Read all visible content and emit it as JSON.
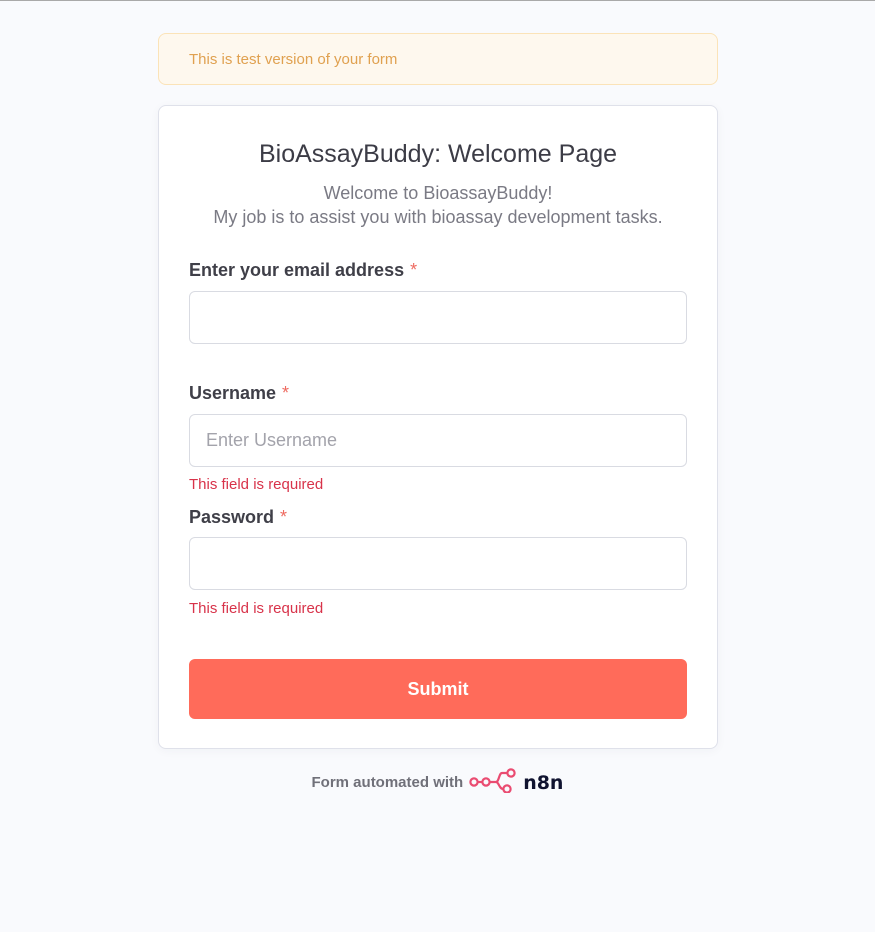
{
  "banner": {
    "text": "This is test version of your form"
  },
  "form": {
    "title": "BioAssayBuddy: Welcome Page",
    "description_line1": "Welcome to BioassayBuddy!",
    "description_line2": "My job is to assist you with bioassay development tasks.",
    "required_mark": "*",
    "fields": [
      {
        "label": "Enter your email address",
        "value": "",
        "placeholder": "",
        "error": ""
      },
      {
        "label": "Username",
        "value": "",
        "placeholder": "Enter Username",
        "error": "This field is required"
      },
      {
        "label": "Password",
        "value": "",
        "placeholder": "",
        "error": "This field is required"
      }
    ],
    "submit_label": "Submit"
  },
  "footer": {
    "text": "Form automated with",
    "brand": "n8n",
    "brand_icon": "n8n-logo-icon"
  },
  "colors": {
    "accent": "#ff6b5a",
    "error": "#d8334a",
    "banner_text": "#e0a150",
    "brand_icon": "#ea4b71"
  }
}
